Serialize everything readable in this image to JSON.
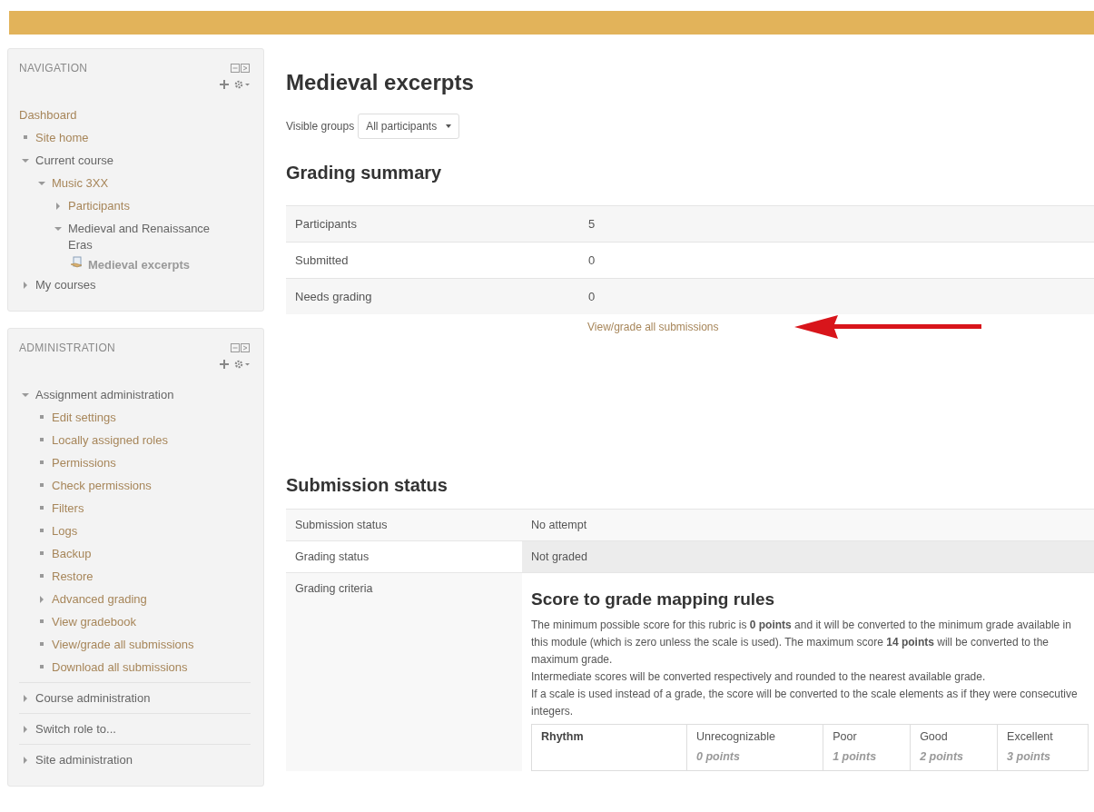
{
  "navigation": {
    "title": "NAVIGATION",
    "items": [
      {
        "label": "Dashboard",
        "kind": "plain",
        "link": true
      },
      {
        "label": "Site home",
        "kind": "leaf",
        "link": true
      },
      {
        "label": "Current course",
        "kind": "branch",
        "link": false,
        "expanded": true,
        "children": [
          {
            "label": "Music 3XX",
            "kind": "branch",
            "link": true,
            "expanded": true,
            "children": [
              {
                "label": "Participants",
                "kind": "branch",
                "link": true,
                "expanded": false
              },
              {
                "label": "Medieval and Renaissance Eras",
                "kind": "branch",
                "link": false,
                "expanded": true,
                "children": [
                  {
                    "label": "Medieval excerpts",
                    "kind": "activity"
                  }
                ]
              }
            ]
          }
        ]
      },
      {
        "label": "My courses",
        "kind": "branch",
        "link": false,
        "expanded": false
      }
    ]
  },
  "administration": {
    "title": "ADMINISTRATION",
    "items": [
      {
        "label": "Assignment administration",
        "kind": "branch",
        "link": false,
        "expanded": true,
        "children": [
          {
            "label": "Edit settings",
            "kind": "leaf",
            "link": true
          },
          {
            "label": "Locally assigned roles",
            "kind": "leaf",
            "link": true
          },
          {
            "label": "Permissions",
            "kind": "leaf",
            "link": true
          },
          {
            "label": "Check permissions",
            "kind": "leaf",
            "link": true
          },
          {
            "label": "Filters",
            "kind": "leaf",
            "link": true
          },
          {
            "label": "Logs",
            "kind": "leaf",
            "link": true
          },
          {
            "label": "Backup",
            "kind": "leaf",
            "link": true
          },
          {
            "label": "Restore",
            "kind": "leaf",
            "link": true
          },
          {
            "label": "Advanced grading",
            "kind": "branch",
            "link": true,
            "expanded": false
          },
          {
            "label": "View gradebook",
            "kind": "leaf",
            "link": true
          },
          {
            "label": "View/grade all submissions",
            "kind": "leaf",
            "link": true
          },
          {
            "label": "Download all submissions",
            "kind": "leaf",
            "link": true
          }
        ]
      },
      {
        "label": "Course administration",
        "kind": "branch",
        "link": false,
        "expanded": false
      },
      {
        "label": "Switch role to...",
        "kind": "branch",
        "link": false,
        "expanded": false
      },
      {
        "label": "Site administration",
        "kind": "branch",
        "link": false,
        "expanded": false
      }
    ]
  },
  "page": {
    "title": "Medieval excerpts",
    "group_filter": {
      "label": "Visible groups",
      "value": "All participants"
    },
    "grading_summary": {
      "title": "Grading summary",
      "rows": [
        {
          "label": "Participants",
          "value": "5"
        },
        {
          "label": "Submitted",
          "value": "0"
        },
        {
          "label": "Needs grading",
          "value": "0"
        }
      ],
      "link": "View/grade all submissions"
    },
    "submission_status": {
      "title": "Submission status",
      "rows": [
        {
          "label": "Submission status",
          "kind": "text",
          "value": "No attempt"
        },
        {
          "label": "Grading status",
          "kind": "text",
          "value": "Not graded"
        },
        {
          "label": "Grading criteria",
          "kind": "rubric",
          "rubric": {
            "title": "Score to grade mapping rules",
            "paragraphs": [
              "The minimum possible score for this rubric is **0 points** and it will be converted to the minimum grade available in this module (which is zero unless the scale is used). The maximum score **14 points** will be converted to the maximum grade.",
              "Intermediate scores will be converted respectively and rounded to the nearest available grade.",
              "If a scale is used instead of a grade, the score will be converted to the scale elements as if they were consecutive integers."
            ],
            "criteria": [
              {
                "name": "Rhythm",
                "levels": [
                  {
                    "definition": "Unrecognizable",
                    "score": "0 points"
                  },
                  {
                    "definition": "Poor",
                    "score": "1 points"
                  },
                  {
                    "definition": "Good",
                    "score": "2 points"
                  },
                  {
                    "definition": "Excellent",
                    "score": "3 points"
                  }
                ]
              }
            ]
          }
        }
      ]
    }
  }
}
